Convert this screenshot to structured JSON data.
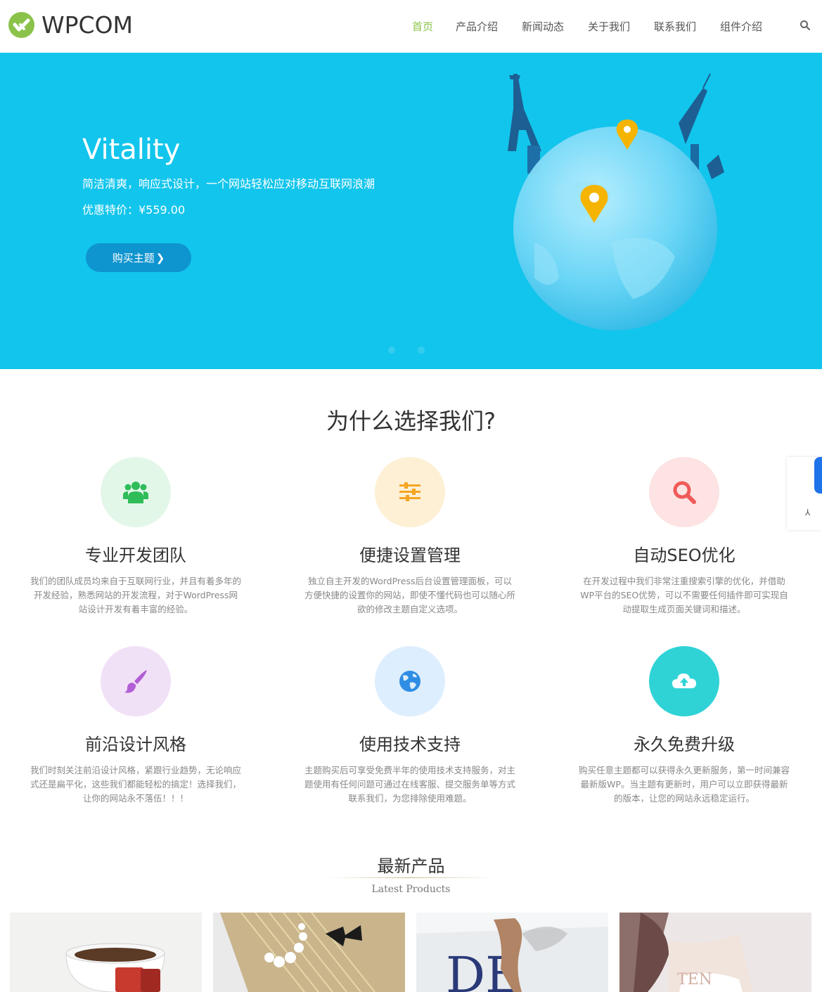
{
  "header": {
    "logo_text": "WPCOM",
    "nav": [
      {
        "label": "首页",
        "active": true
      },
      {
        "label": "产品介绍",
        "active": false
      },
      {
        "label": "新闻动态",
        "active": false
      },
      {
        "label": "关于我们",
        "active": false
      },
      {
        "label": "联系我们",
        "active": false
      },
      {
        "label": "组件介绍",
        "active": false
      }
    ],
    "search_icon": "search-icon"
  },
  "hero": {
    "title": "Vitality",
    "subtitle": "简洁清爽，响应式设计，一个网站轻松应对移动互联网浪潮",
    "price": "优惠特价：¥559.00",
    "button_label": "购买主题",
    "background": "#12c5ec",
    "button_color": "#0e94cf"
  },
  "why": {
    "title": "为什么选择我们?",
    "features": [
      {
        "title": "专业开发团队",
        "desc": "我们的团队成员均来自于互联网行业，并且有着多年的开发经验，熟悉网站的开发流程，对于WordPress网站设计开发有着丰富的经验。",
        "icon": "team-icon",
        "bg": "#e3f7e9",
        "color": "#2fbd5a"
      },
      {
        "title": "便捷设置管理",
        "desc": "独立自主开发的WordPress后台设置管理面板，可以方便快捷的设置你的网站，即使不懂代码也可以随心所欲的修改主题自定义选项。",
        "icon": "sliders-icon",
        "bg": "#fdf0d5",
        "color": "#f5a623"
      },
      {
        "title": "自动SEO优化",
        "desc": "在开发过程中我们非常注重搜索引擎的优化，并借助WP平台的SEO优势，可以不需要任何插件即可实现自动提取生成页面关键词和描述。",
        "icon": "magnifier-icon",
        "bg": "#fde3e3",
        "color": "#f05a5a"
      },
      {
        "title": "前沿设计风格",
        "desc": "我们时刻关注前沿设计风格，紧跟行业趋势，无论响应式还是扁平化，这些我们都能轻松的搞定！选择我们，让你的网站永不落伍！！！",
        "icon": "brush-icon",
        "bg": "#f1e1f7",
        "color": "#b25fd6"
      },
      {
        "title": "使用技术支持",
        "desc": "主题购买后可享受免费半年的使用技术支持服务，对主题使用有任何问题可通过在线客服、提交服务单等方式联系我们，为您排除使用难题。",
        "icon": "globe-icon",
        "bg": "#ddeefe",
        "color": "#2f8de4"
      },
      {
        "title": "永久免费升级",
        "desc": "购买任意主题都可以获得永久更新服务，第一时间兼容最新版WP。当主题有更新时，用户可以立即获得最新的版本，让您的网站永远稳定运行。",
        "icon": "cloud-upload-icon",
        "bg": "#2fd3d6",
        "color": "#ffffff"
      }
    ]
  },
  "latest": {
    "title": "最新产品",
    "subtitle": "Latest Products"
  }
}
